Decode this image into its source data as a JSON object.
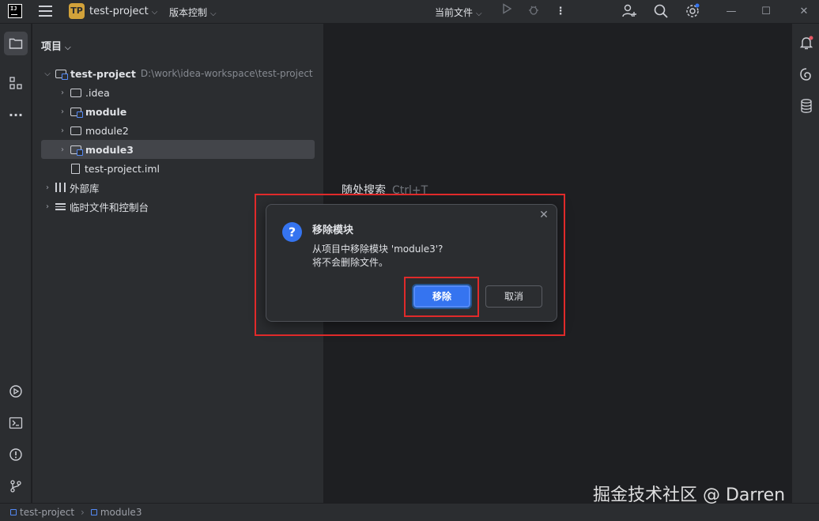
{
  "titlebar": {
    "logo_text": "IJ",
    "project_badge": "TP",
    "project_name": "test-project",
    "vcs_label": "版本控制",
    "run_config": "当前文件",
    "icons": [
      "hamburger-icon",
      "run-icon",
      "debug-icon",
      "more-icon",
      "add-user-icon",
      "search-icon",
      "settings-icon",
      "minimize-icon",
      "maximize-icon",
      "close-icon"
    ]
  },
  "leftstrip": {
    "icons": [
      "project-folder-icon",
      "structure-icon",
      "more-tools-icon",
      "services-icon",
      "terminal-icon",
      "problems-icon",
      "git-icon"
    ]
  },
  "rightstrip": {
    "icons": [
      "notifications-icon",
      "ai-assistant-icon",
      "database-icon"
    ]
  },
  "project_panel": {
    "title": "项目",
    "tree": [
      {
        "label": "test-project",
        "path": "D:\\work\\idea-workspace\\test-project"
      },
      {
        "label": ".idea"
      },
      {
        "label": "module"
      },
      {
        "label": "module2"
      },
      {
        "label": "module3"
      },
      {
        "label": "test-project.iml"
      },
      {
        "label": "外部库"
      },
      {
        "label": "临时文件和控制台"
      }
    ]
  },
  "editor": {
    "hint_text": "随处搜索",
    "hint_shortcut": "Ctrl+T"
  },
  "dialog": {
    "title": "移除模块",
    "message_line1": "从项目中移除模块 'module3'?",
    "message_line2": "将不会删除文件。",
    "primary_button": "移除",
    "secondary_button": "取消"
  },
  "statusbar": {
    "breadcrumb": [
      "test-project",
      "module3"
    ]
  },
  "watermark": "掘金技术社区 @ Darren",
  "colors": {
    "accent": "#3574f0",
    "annotation_red": "#e02a2a",
    "badge": "#d2a23a"
  }
}
